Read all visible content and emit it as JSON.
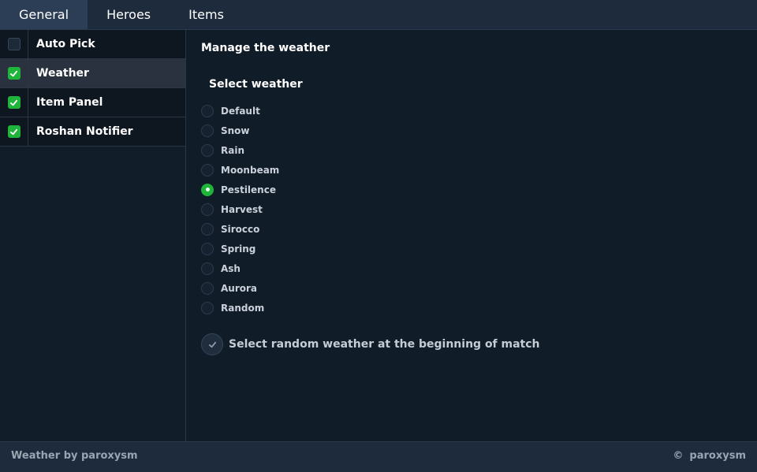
{
  "tabs": [
    {
      "label": "General",
      "active": true
    },
    {
      "label": "Heroes",
      "active": false
    },
    {
      "label": "Items",
      "active": false
    }
  ],
  "sidebar": {
    "items": [
      {
        "label": "Auto Pick",
        "checked": false,
        "selected": false
      },
      {
        "label": "Weather",
        "checked": true,
        "selected": true
      },
      {
        "label": "Item Panel",
        "checked": true,
        "selected": false
      },
      {
        "label": "Roshan Notifier",
        "checked": true,
        "selected": false
      }
    ]
  },
  "main": {
    "title": "Manage the weather",
    "section_title": "Select weather",
    "options": [
      "Default",
      "Snow",
      "Rain",
      "Moonbeam",
      "Pestilence",
      "Harvest",
      "Sirocco",
      "Spring",
      "Ash",
      "Aurora",
      "Random"
    ],
    "selected_option": "Pestilence",
    "random_toggle_label": "Select random weather at the beginning of match",
    "random_toggle_checked": false
  },
  "footer": {
    "left_text": "Weather by paroxysm",
    "copyright_symbol": "©",
    "right_text": "paroxysm"
  },
  "colors": {
    "accent_green": "#1fb43a",
    "background": "#111c29",
    "bar": "#1d2b3d"
  },
  "icons": {
    "checkbox_checked": "check-icon",
    "toggle": "check-icon"
  }
}
